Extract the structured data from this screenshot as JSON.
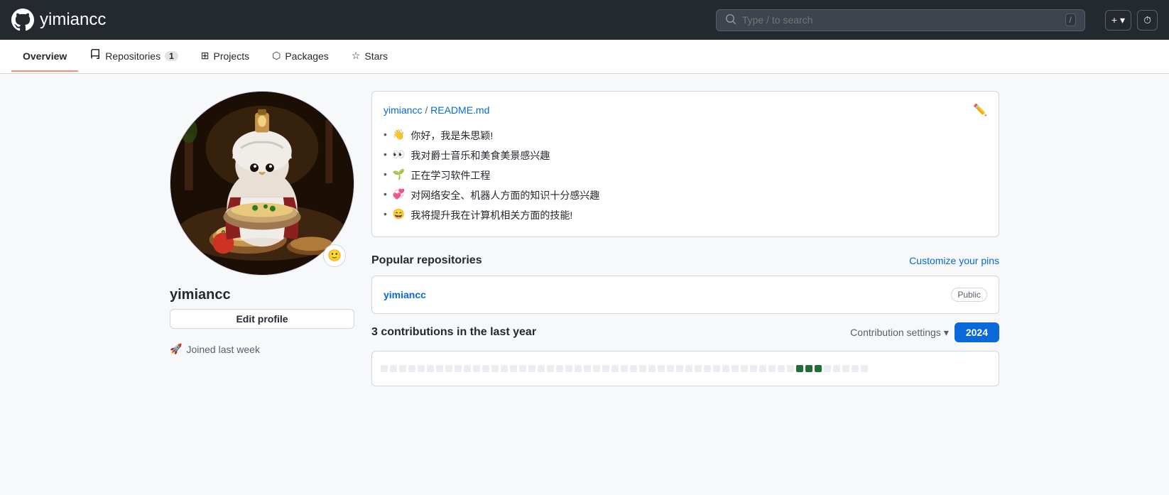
{
  "header": {
    "logo_label": "GitHub",
    "username": "yimiancc",
    "search_placeholder": "Type / to search",
    "search_kbd": "/",
    "add_button_label": "+",
    "clock_icon_label": "⏱"
  },
  "nav": {
    "items": [
      {
        "id": "overview",
        "label": "Overview",
        "active": true
      },
      {
        "id": "repositories",
        "label": "Repositories",
        "badge": "1"
      },
      {
        "id": "projects",
        "label": "Projects"
      },
      {
        "id": "packages",
        "label": "Packages"
      },
      {
        "id": "stars",
        "label": "Stars"
      }
    ]
  },
  "sidebar": {
    "username": "yimiancc",
    "edit_profile_label": "Edit profile",
    "joined_label": "Joined last week"
  },
  "readme": {
    "file_path_user": "yimiancc",
    "file_path_sep": " / ",
    "file_path_file": "README.md",
    "items": [
      {
        "emoji": "👋",
        "text": "你好，我是朱思颖!"
      },
      {
        "emoji": "👀",
        "text": "我对爵士音乐和美食美景感兴趣"
      },
      {
        "emoji": "🌱",
        "text": "正在学习软件工程"
      },
      {
        "emoji": "💞",
        "text": "对网络安全、机器人方面的知识十分感兴趣"
      },
      {
        "emoji": "😄",
        "text": "我将提升我在计算机相关方面的技能!"
      }
    ]
  },
  "popular_repos": {
    "section_title": "Popular repositories",
    "customize_label": "Customize your pins",
    "repos": [
      {
        "name": "yimiancc",
        "badge": "Public"
      }
    ]
  },
  "contributions": {
    "title": "3 contributions in the last year",
    "settings_label": "Contribution settings",
    "year_label": "2024"
  }
}
